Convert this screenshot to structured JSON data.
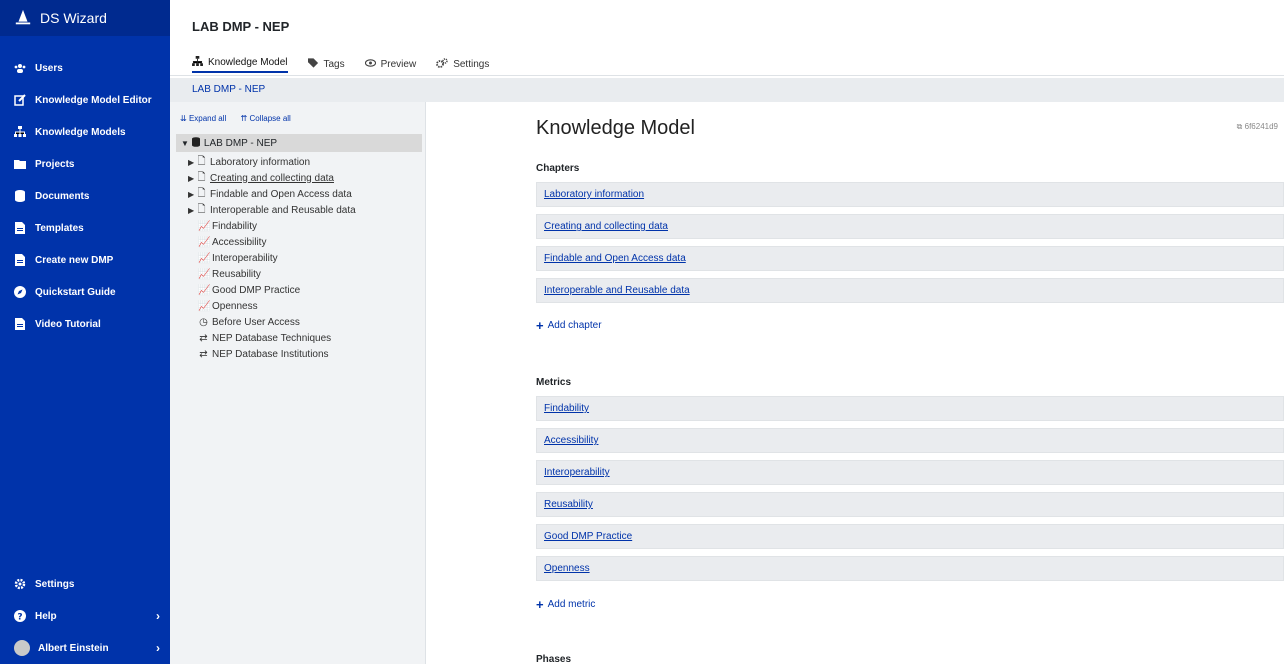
{
  "sidebar": {
    "brand": "DS Wizard",
    "items": [
      {
        "label": "Users",
        "icon": "users-icon"
      },
      {
        "label": "Knowledge Model Editor",
        "icon": "edit-icon"
      },
      {
        "label": "Knowledge Models",
        "icon": "sitemap-icon"
      },
      {
        "label": "Projects",
        "icon": "folder-icon"
      },
      {
        "label": "Documents",
        "icon": "database-icon"
      },
      {
        "label": "Templates",
        "icon": "file-icon"
      },
      {
        "label": "Create new DMP",
        "icon": "file-icon"
      },
      {
        "label": "Quickstart Guide",
        "icon": "compass-icon"
      },
      {
        "label": "Video Tutorial",
        "icon": "file-icon"
      }
    ],
    "bottom": {
      "settings": "Settings",
      "help": "Help",
      "user": "Albert Einstein"
    }
  },
  "header": {
    "title": "LAB DMP - NEP",
    "tabs": [
      {
        "label": "Knowledge Model",
        "active": true
      },
      {
        "label": "Tags",
        "active": false
      },
      {
        "label": "Preview",
        "active": false
      },
      {
        "label": "Settings",
        "active": false
      }
    ]
  },
  "breadcrumb": "LAB DMP - NEP",
  "tree": {
    "expand_all": "Expand all",
    "collapse_all": "Collapse all",
    "root": "LAB DMP - NEP",
    "nodes": [
      {
        "label": "Laboratory information",
        "kind": "chapter"
      },
      {
        "label": "Creating and collecting data",
        "kind": "chapter"
      },
      {
        "label": "Findable and Open Access data",
        "kind": "chapter"
      },
      {
        "label": "Interoperable and Reusable data",
        "kind": "chapter"
      },
      {
        "label": "Findability",
        "kind": "metric"
      },
      {
        "label": "Accessibility",
        "kind": "metric"
      },
      {
        "label": "Interoperability",
        "kind": "metric"
      },
      {
        "label": "Reusability",
        "kind": "metric"
      },
      {
        "label": "Good DMP Practice",
        "kind": "metric"
      },
      {
        "label": "Openness",
        "kind": "metric"
      },
      {
        "label": "Before User Access",
        "kind": "phase"
      },
      {
        "label": "NEP Database Techniques",
        "kind": "integration"
      },
      {
        "label": "NEP Database Institutions",
        "kind": "integration"
      }
    ]
  },
  "main": {
    "title": "Knowledge Model",
    "uuid": "6f6241d9",
    "chapters_title": "Chapters",
    "chapters": [
      "Laboratory information",
      "Creating and collecting data",
      "Findable and Open Access data",
      "Interoperable and Reusable data"
    ],
    "add_chapter": "Add chapter",
    "metrics_title": "Metrics",
    "metrics": [
      "Findability",
      "Accessibility",
      "Interoperability",
      "Reusability",
      "Good DMP Practice",
      "Openness"
    ],
    "add_metric": "Add metric",
    "phases_title": "Phases"
  },
  "colors": {
    "sidebar": "#0033aa",
    "link": "#0033aa",
    "panel_bg": "#f1f3f5"
  }
}
